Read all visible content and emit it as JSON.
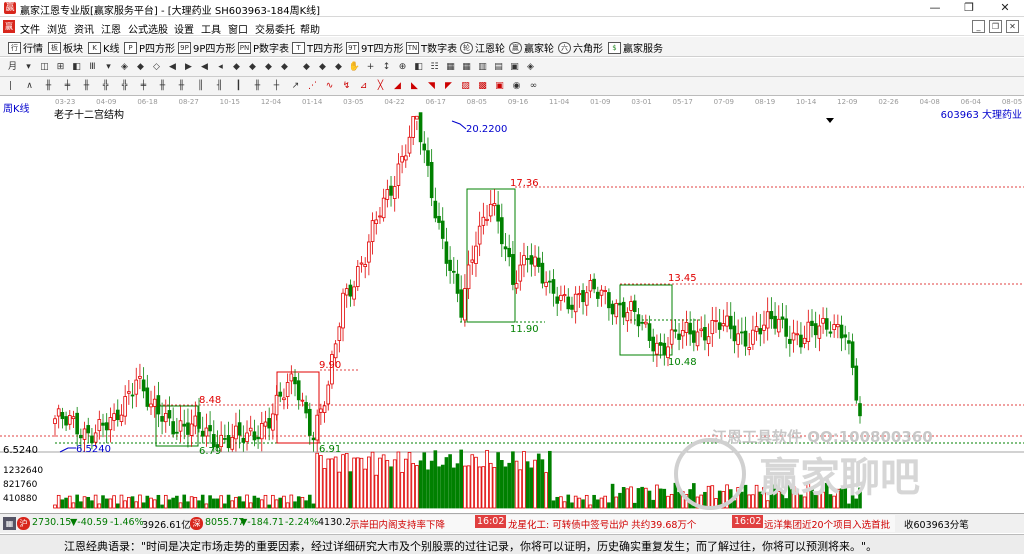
{
  "window": {
    "title": "赢家江恩专业版[赢家服务平台] - [大理药业  SH603963-184周K线]",
    "logo_text": "赢",
    "minimize_label": "—",
    "restore_label": "❐",
    "close_label": "✕"
  },
  "menu": {
    "items": [
      "文件",
      "浏览",
      "资讯",
      "江恩",
      "公式选股",
      "设置",
      "工具",
      "窗口",
      "交易委托",
      "帮助"
    ],
    "mdi_buttons": [
      "_",
      "❐",
      "✕"
    ]
  },
  "funcbar": {
    "items": [
      {
        "icon": "行",
        "label": "行情"
      },
      {
        "icon": "板",
        "label": "板块"
      },
      {
        "icon": "K",
        "label": "K线"
      },
      {
        "icon": "P",
        "label": "P四方形"
      },
      {
        "icon": "9P",
        "label": "9P四方形"
      },
      {
        "icon": "PN",
        "label": "P数字表"
      },
      {
        "icon": "T",
        "label": "T四方形"
      },
      {
        "icon": "9T",
        "label": "9T四方形"
      },
      {
        "icon": "TN",
        "label": "T数字表"
      },
      {
        "icon": "轮",
        "label": "江恩轮"
      },
      {
        "icon": "赢",
        "label": "赢家轮"
      },
      {
        "icon": "六",
        "label": "六角形"
      },
      {
        "icon": "$",
        "label": "赢家服务"
      }
    ]
  },
  "chart": {
    "period_label": "周K线",
    "structure_label": "老子十二宫结构",
    "stock_label": "603963  大理药业",
    "top_dates": [
      "03-23",
      "04-09",
      "06-18",
      "08-27",
      "10-15",
      "12-04",
      "01-14",
      "03-05",
      "04-22",
      "06-17",
      "08-05",
      "09-16",
      "11-04",
      "01-09",
      "03-01",
      "05-17",
      "07-09",
      "08-19",
      "10-14",
      "12-09",
      "02-26",
      "04-08",
      "06-04",
      "08-05"
    ],
    "price_labels": {
      "high": "20.2200",
      "low": "6.5240",
      "axis_low": "6.5240",
      "level_1736": "17.36",
      "level_1345": "13.45",
      "level_1190": "11.90",
      "level_1048": "10.48",
      "level_990": "9.90",
      "level_848": "8.48",
      "level_691": "6.91",
      "level_679": "6.79"
    },
    "volume_labels": [
      "1232640",
      "821760",
      "410880"
    ],
    "watermark_1": "江恩工具软件  QQ:100800360",
    "watermark_2": "赢家聊吧",
    "colors": {
      "up": "#e00000",
      "down": "#008000",
      "level_line": "#e04040",
      "box": "#008000",
      "box_red": "#e00000"
    },
    "chart_data": {
      "type": "candlestick",
      "title": "老子十二宫结构",
      "symbol": "603963 大理药业",
      "period": "weekly",
      "y_high": 20.22,
      "y_low": 6.524,
      "levels": [
        20.22,
        17.36,
        13.45,
        11.9,
        10.48,
        9.9,
        8.48,
        6.91,
        6.79,
        6.524
      ],
      "volume_ticks": [
        1232640,
        821760,
        410880
      ]
    }
  },
  "status": {
    "sh": {
      "price": "2730.15",
      "change": "▼-40.59",
      "pct": "-1.46%",
      "amount": "3926.61亿"
    },
    "sz": {
      "price": "8055.77",
      "change": "▼-184.71",
      "pct": "-2.24%",
      "amount": "4130.2"
    },
    "news": [
      {
        "text": "示岸田内阁支持率下降",
        "time": "16:02"
      },
      {
        "text": "龙星化工: 可转债中签号出炉 共约39.68万个",
        "time": "16:02"
      },
      {
        "text": "远洋集团近20个项目入选首批"
      }
    ],
    "right_text": "收603963分笔"
  },
  "quote": {
    "text": "江恩经典语录：\"时间是决定市场走势的重要因素，经过详细研究大市及个别股票的过往记录，你将可以证明，历史确实重复发生；而了解过往，你将可以预测将来。\"。"
  }
}
